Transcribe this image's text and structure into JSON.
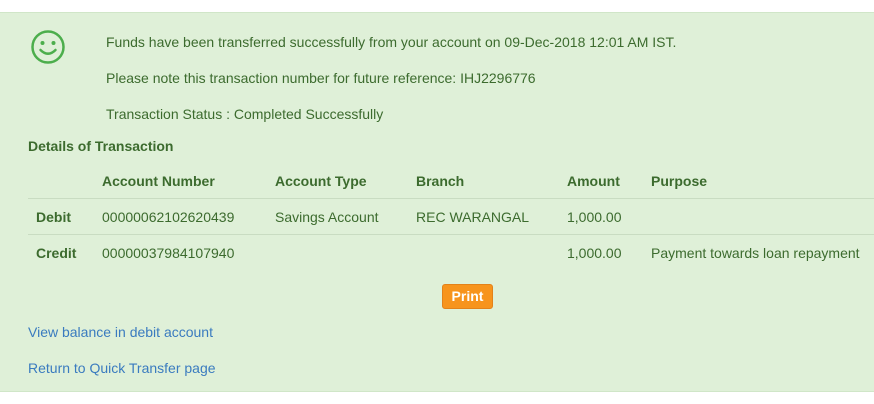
{
  "confirmation": {
    "message": "Funds have been transferred successfully from your account on  09-Dec-2018 12:01 AM IST.",
    "reference_note": "Please note this transaction number for future reference: IHJ2296776",
    "status": "Transaction Status : Completed Successfully",
    "icon": "smiley-icon",
    "accent_color": "#4cae4c"
  },
  "details": {
    "title": "Details of Transaction",
    "headers": [
      "",
      "Account Number",
      "Account Type",
      "Branch",
      "Amount",
      "Purpose"
    ],
    "rows": [
      [
        "Debit",
        "00000062102620439",
        "Savings Account",
        "REC WARANGAL",
        "1,000.00",
        ""
      ],
      [
        "Credit",
        "00000037984107940",
        "",
        "",
        "1,000.00",
        "Payment towards loan repayment"
      ]
    ]
  },
  "actions": {
    "print_label": "Print",
    "print_color": "#f7941d",
    "view_balance_link": "View balance in debit account",
    "quick_transfer_link": "Return to Quick Transfer page"
  }
}
